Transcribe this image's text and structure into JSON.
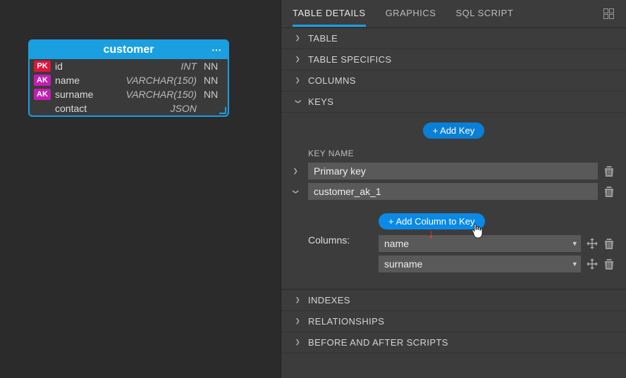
{
  "entity": {
    "name": "customer",
    "columns": [
      {
        "badge": "PK",
        "name": "id",
        "type": "INT",
        "null": "NN"
      },
      {
        "badge": "AK",
        "name": "name",
        "type": "VARCHAR(150)",
        "null": "NN"
      },
      {
        "badge": "AK",
        "name": "surname",
        "type": "VARCHAR(150)",
        "null": "NN"
      },
      {
        "badge": "",
        "name": "contact",
        "type": "JSON",
        "null": ""
      }
    ]
  },
  "tabs": {
    "details": "TABLE DETAILS",
    "graphics": "GRAPHICS",
    "sql": "SQL SCRIPT"
  },
  "sections": {
    "table": "TABLE",
    "specifics": "TABLE SPECIFICS",
    "columns": "COLUMNS",
    "keys": "KEYS",
    "indexes": "INDEXES",
    "relationships": "RELATIONSHIPS",
    "scripts": "BEFORE AND AFTER SCRIPTS"
  },
  "keys": {
    "add_key_label": "+ Add Key",
    "key_name_label": "KEY NAME",
    "columns_label": "Columns:",
    "add_col_label": "+ Add Column to Key",
    "entries": [
      {
        "name": "Primary key",
        "expanded": false
      },
      {
        "name": "customer_ak_1",
        "expanded": true,
        "columns": [
          {
            "value": "name"
          },
          {
            "value": "surname"
          }
        ]
      }
    ]
  }
}
